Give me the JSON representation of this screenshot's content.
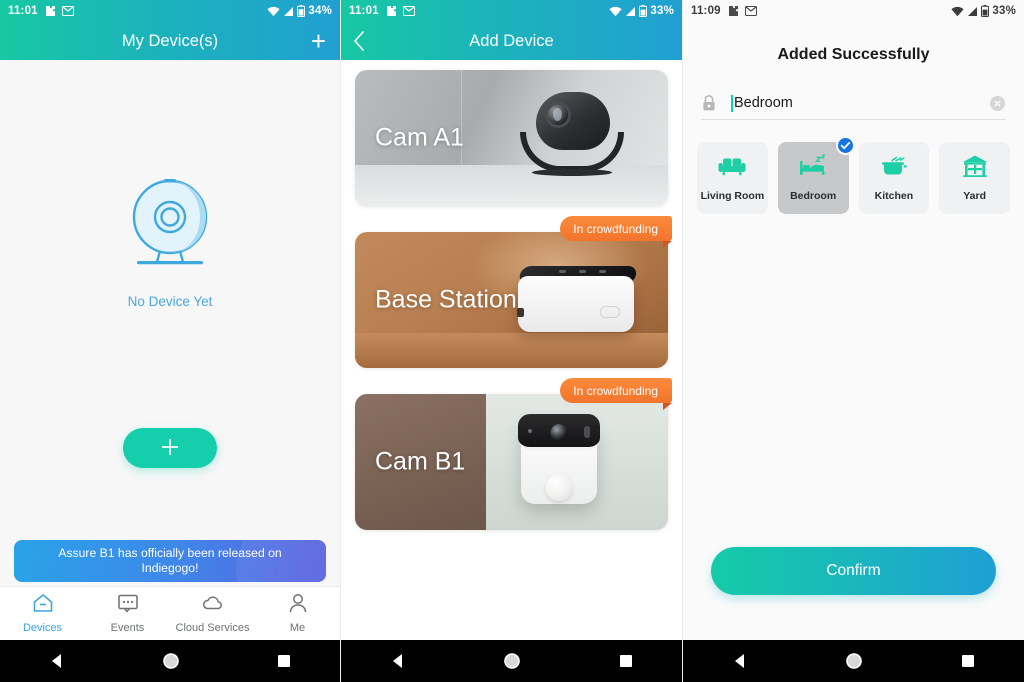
{
  "panel1": {
    "status": {
      "time": "11:01",
      "battery": "34%",
      "icons": [
        "puzzle-icon",
        "mail-icon",
        "wifi-icon",
        "signal-icon",
        "battery-icon"
      ]
    },
    "appbar": {
      "title": "My Device(s)",
      "add_icon": "plus-icon"
    },
    "empty": {
      "icon": "camera-device-icon",
      "label": "No Device Yet"
    },
    "fab": {
      "icon": "plus-icon"
    },
    "promo": {
      "text": "Assure B1 has officially been released on Indiegogo!"
    },
    "tabs": [
      {
        "label": "Devices",
        "icon": "home-icon",
        "active": true
      },
      {
        "label": "Events",
        "icon": "chat-bubble-icon",
        "active": false
      },
      {
        "label": "Cloud Services",
        "icon": "cloud-icon",
        "active": false
      },
      {
        "label": "Me",
        "icon": "person-icon",
        "active": false
      }
    ]
  },
  "panel2": {
    "status": {
      "time": "11:01",
      "battery": "33%"
    },
    "appbar": {
      "title": "Add Device",
      "back_icon": "chevron-left-icon"
    },
    "cards": [
      {
        "label": "Cam A1",
        "badge": ""
      },
      {
        "label": "Base Station",
        "badge": "In crowdfunding"
      },
      {
        "label": "Cam B1",
        "badge": "In crowdfunding"
      }
    ]
  },
  "panel3": {
    "status": {
      "time": "11:09",
      "battery": "33%"
    },
    "title": "Added Successfully",
    "name_field": {
      "value": "Bedroom",
      "lock_icon": "lock-icon",
      "clear_icon": "clear-circle-icon"
    },
    "rooms": [
      {
        "label": "Living Room",
        "icon": "sofa-icon",
        "selected": false
      },
      {
        "label": "Bedroom",
        "icon": "bed-icon",
        "selected": true
      },
      {
        "label": "Kitchen",
        "icon": "cooking-pot-icon",
        "selected": false
      },
      {
        "label": "Yard",
        "icon": "gazebo-icon",
        "selected": false
      }
    ],
    "confirm_label": "Confirm"
  },
  "navbar": {
    "back": "back-triangle-icon",
    "home": "home-circle-icon",
    "recents": "recents-square-icon"
  },
  "colors": {
    "teal": "#14ceac",
    "blue": "#1f9fd5",
    "orange": "#f2742c",
    "link_blue": "#3ba7e0"
  }
}
